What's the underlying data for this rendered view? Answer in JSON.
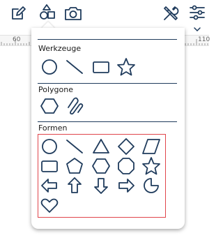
{
  "toolbar": {
    "icons": [
      "edit-icon",
      "shapes-icon",
      "camera-icon",
      "tools-icon",
      "settings-sliders-icon"
    ],
    "accent_color": "#1f3b5c"
  },
  "ruler": {
    "labels": [
      "60",
      "110"
    ]
  },
  "panel": {
    "sections": [
      {
        "title": "Werkzeuge",
        "items": [
          "circle",
          "line",
          "rectangle",
          "star"
        ]
      },
      {
        "title": "Polygone",
        "items": [
          "hexagon",
          "freehand-curve"
        ]
      },
      {
        "title": "Formen",
        "items": [
          "circle",
          "line",
          "triangle",
          "diamond",
          "parallelogram",
          "rounded-rectangle",
          "pentagon",
          "hexagon",
          "octagon",
          "star",
          "arrow-left",
          "arrow-up",
          "arrow-down",
          "arrow-right",
          "pie",
          "heart"
        ]
      }
    ],
    "highlight_color": "#e0454b"
  }
}
